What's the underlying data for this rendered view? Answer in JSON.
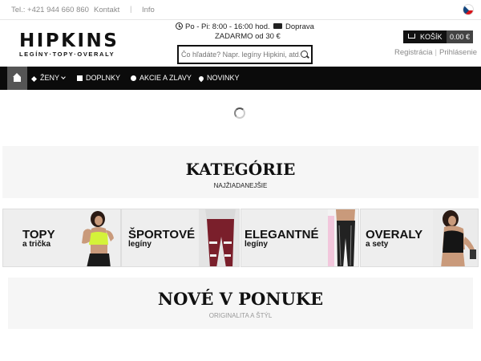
{
  "topbar": {
    "phone": "Tel.: +421 944 660 860",
    "contact_label": "Kontakt",
    "separator": "|",
    "info_label": "Info",
    "language_flag": "czech-flag"
  },
  "header": {
    "logo_brand": "HIPKINS",
    "logo_tagline": "LEGÍNY·TOPY·OVERALY",
    "hours": "Po - Pi: 8:00 - 16:00 hod.",
    "shipping_line1": "Doprava",
    "shipping_line2": "ZADARMO od 30 €",
    "search_placeholder": "Čo hľadáte? Napr. legíny Hipkini, atd.",
    "cart_label": "KOŠÍK",
    "cart_total": "0.00 €",
    "register_label": "Registrácia",
    "account_separator": "|",
    "login_label": "Prihlásenie"
  },
  "nav": {
    "items": [
      {
        "label": "ŽENY",
        "icon": "female-icon"
      },
      {
        "label": "DOPLNKY",
        "icon": "box-icon"
      },
      {
        "label": "AKCIE A ZLAVY",
        "icon": "bomb-icon"
      },
      {
        "label": "NOVINKY",
        "icon": "heart-icon"
      }
    ]
  },
  "categories": {
    "title": "KATEGÓRIE",
    "subtitle": "NAJŽIADANEJŠIE",
    "cards": [
      {
        "line1": "TOPY",
        "line2": "a trička"
      },
      {
        "line1": "ŠPORTOVÉ",
        "line2": "legíny"
      },
      {
        "line1": "ELEGANTNÉ",
        "line2": "legíny"
      },
      {
        "line1": "OVERALY",
        "line2": "a sety"
      }
    ]
  },
  "new_section": {
    "title": "NOVÉ V PONUKE",
    "subtitle": "ORIGINALITA A ŠTÝL"
  },
  "colors": {
    "nav_bg": "#0b0b0b",
    "accent_neon": "#d4f23a",
    "burgundy": "#7a1f2b",
    "panel_bg": "#f6f6f6"
  }
}
